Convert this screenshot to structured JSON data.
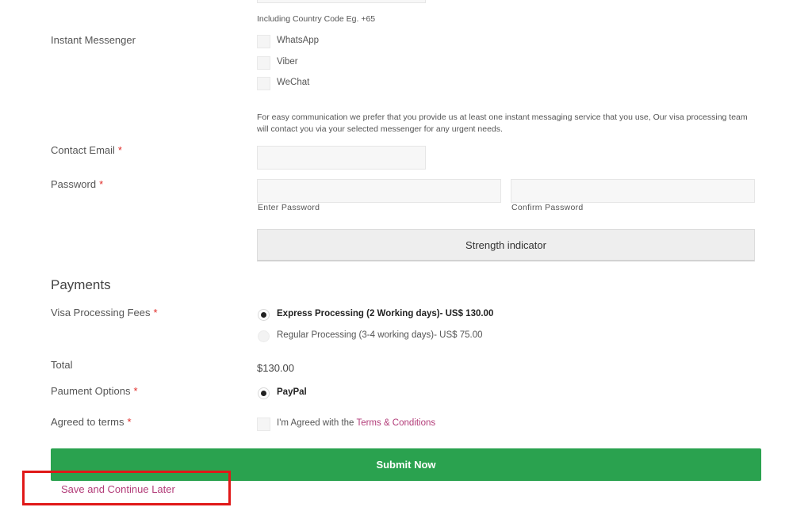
{
  "phone": {
    "hint": "Including Country Code Eg. +65"
  },
  "messenger": {
    "label": "Instant Messenger",
    "options": [
      "WhatsApp",
      "Viber",
      "WeChat"
    ],
    "help": "For easy communication we prefer that you provide us at least one instant messaging service that you use, Our visa processing team will contact you via your selected messenger for any urgent needs."
  },
  "email": {
    "label": "Contact Email",
    "required_mark": "*",
    "value": ""
  },
  "password": {
    "label": "Password",
    "required_mark": "*",
    "enter_label": "Enter Password",
    "confirm_label": "Confirm Password",
    "strength_label": "Strength indicator"
  },
  "payments": {
    "section_title": "Payments",
    "fees_label": "Visa Processing Fees",
    "required_mark": "*",
    "fee_options": [
      {
        "label": "Express Processing (2 Working days)- US$ 130.00",
        "selected": true
      },
      {
        "label": "Regular Processing (3-4 working days)- US$ 75.00",
        "selected": false
      }
    ],
    "total_label": "Total",
    "total_value": "$130.00",
    "payment_options_label": "Paument Options",
    "payment_method": "PayPal"
  },
  "terms": {
    "label": "Agreed to terms",
    "required_mark": "*",
    "text_prefix": "I'm Agreed with the ",
    "link_text": "Terms & Conditions"
  },
  "actions": {
    "submit_label": "Submit Now",
    "save_later_label": "Save and Continue Later"
  },
  "colors": {
    "submit_bg": "#2aa24f",
    "link": "#b23b78",
    "required": "#e02b27",
    "highlight": "#e01818"
  }
}
